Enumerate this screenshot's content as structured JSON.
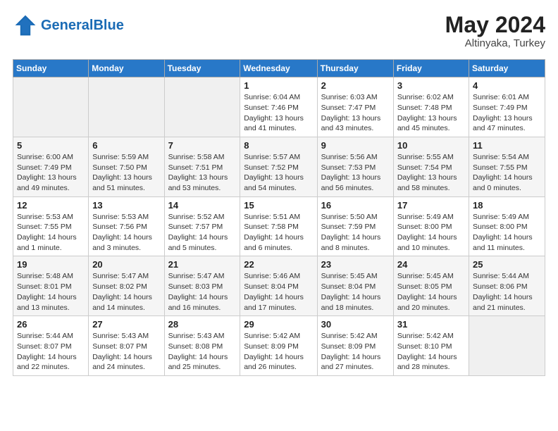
{
  "header": {
    "logo_general": "General",
    "logo_blue": "Blue",
    "month_year": "May 2024",
    "location": "Altinyaka, Turkey"
  },
  "days_of_week": [
    "Sunday",
    "Monday",
    "Tuesday",
    "Wednesday",
    "Thursday",
    "Friday",
    "Saturday"
  ],
  "weeks": [
    [
      {
        "day": "",
        "sunrise": "",
        "sunset": "",
        "daylight": ""
      },
      {
        "day": "",
        "sunrise": "",
        "sunset": "",
        "daylight": ""
      },
      {
        "day": "",
        "sunrise": "",
        "sunset": "",
        "daylight": ""
      },
      {
        "day": "1",
        "sunrise": "Sunrise: 6:04 AM",
        "sunset": "Sunset: 7:46 PM",
        "daylight": "Daylight: 13 hours and 41 minutes."
      },
      {
        "day": "2",
        "sunrise": "Sunrise: 6:03 AM",
        "sunset": "Sunset: 7:47 PM",
        "daylight": "Daylight: 13 hours and 43 minutes."
      },
      {
        "day": "3",
        "sunrise": "Sunrise: 6:02 AM",
        "sunset": "Sunset: 7:48 PM",
        "daylight": "Daylight: 13 hours and 45 minutes."
      },
      {
        "day": "4",
        "sunrise": "Sunrise: 6:01 AM",
        "sunset": "Sunset: 7:49 PM",
        "daylight": "Daylight: 13 hours and 47 minutes."
      }
    ],
    [
      {
        "day": "5",
        "sunrise": "Sunrise: 6:00 AM",
        "sunset": "Sunset: 7:49 PM",
        "daylight": "Daylight: 13 hours and 49 minutes."
      },
      {
        "day": "6",
        "sunrise": "Sunrise: 5:59 AM",
        "sunset": "Sunset: 7:50 PM",
        "daylight": "Daylight: 13 hours and 51 minutes."
      },
      {
        "day": "7",
        "sunrise": "Sunrise: 5:58 AM",
        "sunset": "Sunset: 7:51 PM",
        "daylight": "Daylight: 13 hours and 53 minutes."
      },
      {
        "day": "8",
        "sunrise": "Sunrise: 5:57 AM",
        "sunset": "Sunset: 7:52 PM",
        "daylight": "Daylight: 13 hours and 54 minutes."
      },
      {
        "day": "9",
        "sunrise": "Sunrise: 5:56 AM",
        "sunset": "Sunset: 7:53 PM",
        "daylight": "Daylight: 13 hours and 56 minutes."
      },
      {
        "day": "10",
        "sunrise": "Sunrise: 5:55 AM",
        "sunset": "Sunset: 7:54 PM",
        "daylight": "Daylight: 13 hours and 58 minutes."
      },
      {
        "day": "11",
        "sunrise": "Sunrise: 5:54 AM",
        "sunset": "Sunset: 7:55 PM",
        "daylight": "Daylight: 14 hours and 0 minutes."
      }
    ],
    [
      {
        "day": "12",
        "sunrise": "Sunrise: 5:53 AM",
        "sunset": "Sunset: 7:55 PM",
        "daylight": "Daylight: 14 hours and 1 minute."
      },
      {
        "day": "13",
        "sunrise": "Sunrise: 5:53 AM",
        "sunset": "Sunset: 7:56 PM",
        "daylight": "Daylight: 14 hours and 3 minutes."
      },
      {
        "day": "14",
        "sunrise": "Sunrise: 5:52 AM",
        "sunset": "Sunset: 7:57 PM",
        "daylight": "Daylight: 14 hours and 5 minutes."
      },
      {
        "day": "15",
        "sunrise": "Sunrise: 5:51 AM",
        "sunset": "Sunset: 7:58 PM",
        "daylight": "Daylight: 14 hours and 6 minutes."
      },
      {
        "day": "16",
        "sunrise": "Sunrise: 5:50 AM",
        "sunset": "Sunset: 7:59 PM",
        "daylight": "Daylight: 14 hours and 8 minutes."
      },
      {
        "day": "17",
        "sunrise": "Sunrise: 5:49 AM",
        "sunset": "Sunset: 8:00 PM",
        "daylight": "Daylight: 14 hours and 10 minutes."
      },
      {
        "day": "18",
        "sunrise": "Sunrise: 5:49 AM",
        "sunset": "Sunset: 8:00 PM",
        "daylight": "Daylight: 14 hours and 11 minutes."
      }
    ],
    [
      {
        "day": "19",
        "sunrise": "Sunrise: 5:48 AM",
        "sunset": "Sunset: 8:01 PM",
        "daylight": "Daylight: 14 hours and 13 minutes."
      },
      {
        "day": "20",
        "sunrise": "Sunrise: 5:47 AM",
        "sunset": "Sunset: 8:02 PM",
        "daylight": "Daylight: 14 hours and 14 minutes."
      },
      {
        "day": "21",
        "sunrise": "Sunrise: 5:47 AM",
        "sunset": "Sunset: 8:03 PM",
        "daylight": "Daylight: 14 hours and 16 minutes."
      },
      {
        "day": "22",
        "sunrise": "Sunrise: 5:46 AM",
        "sunset": "Sunset: 8:04 PM",
        "daylight": "Daylight: 14 hours and 17 minutes."
      },
      {
        "day": "23",
        "sunrise": "Sunrise: 5:45 AM",
        "sunset": "Sunset: 8:04 PM",
        "daylight": "Daylight: 14 hours and 18 minutes."
      },
      {
        "day": "24",
        "sunrise": "Sunrise: 5:45 AM",
        "sunset": "Sunset: 8:05 PM",
        "daylight": "Daylight: 14 hours and 20 minutes."
      },
      {
        "day": "25",
        "sunrise": "Sunrise: 5:44 AM",
        "sunset": "Sunset: 8:06 PM",
        "daylight": "Daylight: 14 hours and 21 minutes."
      }
    ],
    [
      {
        "day": "26",
        "sunrise": "Sunrise: 5:44 AM",
        "sunset": "Sunset: 8:07 PM",
        "daylight": "Daylight: 14 hours and 22 minutes."
      },
      {
        "day": "27",
        "sunrise": "Sunrise: 5:43 AM",
        "sunset": "Sunset: 8:07 PM",
        "daylight": "Daylight: 14 hours and 24 minutes."
      },
      {
        "day": "28",
        "sunrise": "Sunrise: 5:43 AM",
        "sunset": "Sunset: 8:08 PM",
        "daylight": "Daylight: 14 hours and 25 minutes."
      },
      {
        "day": "29",
        "sunrise": "Sunrise: 5:42 AM",
        "sunset": "Sunset: 8:09 PM",
        "daylight": "Daylight: 14 hours and 26 minutes."
      },
      {
        "day": "30",
        "sunrise": "Sunrise: 5:42 AM",
        "sunset": "Sunset: 8:09 PM",
        "daylight": "Daylight: 14 hours and 27 minutes."
      },
      {
        "day": "31",
        "sunrise": "Sunrise: 5:42 AM",
        "sunset": "Sunset: 8:10 PM",
        "daylight": "Daylight: 14 hours and 28 minutes."
      },
      {
        "day": "",
        "sunrise": "",
        "sunset": "",
        "daylight": ""
      }
    ]
  ]
}
